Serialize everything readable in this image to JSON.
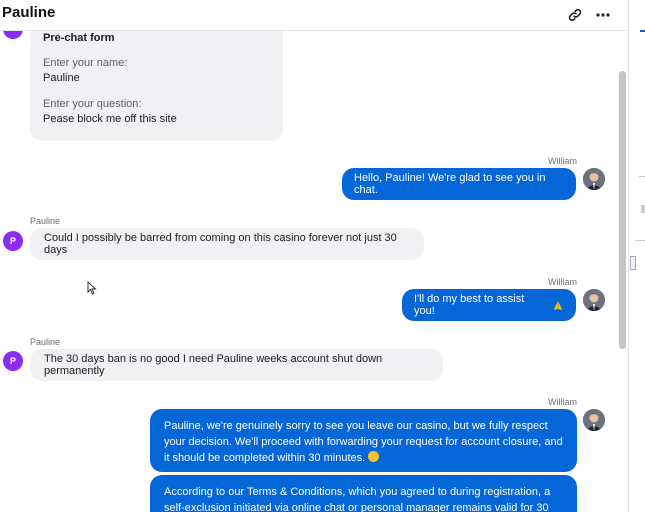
{
  "header": {
    "title": "Pauline",
    "link_icon": "link-icon",
    "more_icon": "more-horizontal-icon"
  },
  "colors": {
    "agent_bubble": "#0566d8",
    "visitor_bubble": "#f1f1f3",
    "visitor_avatar": "#8b2cf5"
  },
  "prechat": {
    "title": "Pre-chat form",
    "name_label": "Enter your name:",
    "name_value": "Pauline",
    "question_label": "Enter your question:",
    "question_value": "Pease block me off this site"
  },
  "messages": [
    {
      "sender": "William",
      "text": "Hello, Pauline! We're glad to see you in chat."
    },
    {
      "sender": "Pauline",
      "avatar": "P",
      "text": "Could I possibly be barred from coming on this casino forever not just 30 days"
    },
    {
      "sender": "William",
      "text": "I'll do my best to assist you!",
      "emoji": "folded-hands-emoji"
    },
    {
      "sender": "Pauline",
      "avatar": "P",
      "text": "The 30 days ban is no good I need Pauline weeks account shut down permanently"
    },
    {
      "sender": "William",
      "text": "Pauline, we're genuinely sorry to see you leave our casino, but we fully respect your decision. We'll proceed with forwarding your request for account closure, and it should be completed within 30 minutes.",
      "emoji": "sad-face-emoji"
    },
    {
      "text": "According to our Terms & Conditions, which you agreed to during registration, a self-exclusion initiated via online chat or personal manager remains valid for 30 days"
    }
  ]
}
